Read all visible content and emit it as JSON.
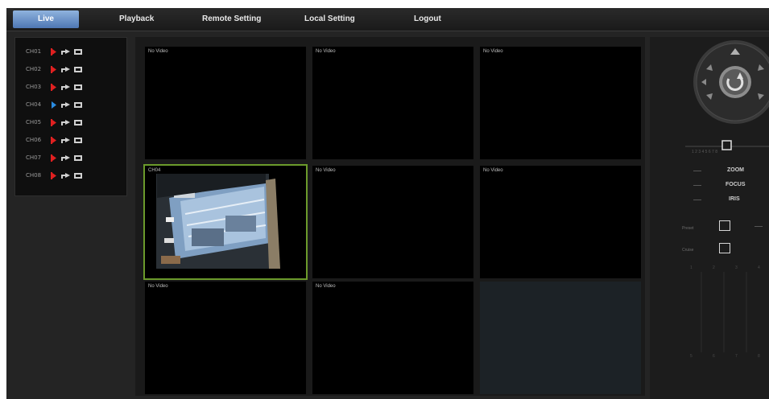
{
  "nav": {
    "tabs": [
      "Live",
      "Playback",
      "Remote Setting",
      "Local Setting",
      "Logout"
    ],
    "active_tab": "Live"
  },
  "channels": [
    {
      "name": "CH01",
      "playing": false
    },
    {
      "name": "CH02",
      "playing": false
    },
    {
      "name": "CH03",
      "playing": false
    },
    {
      "name": "CH04",
      "playing": true
    },
    {
      "name": "CH05",
      "playing": false
    },
    {
      "name": "CH06",
      "playing": false
    },
    {
      "name": "CH07",
      "playing": false
    },
    {
      "name": "CH08",
      "playing": false
    }
  ],
  "tiles": [
    {
      "label": "No Video"
    },
    {
      "label": "No Video"
    },
    {
      "label": "No Video"
    },
    {
      "label": "CH04"
    },
    {
      "label": "No Video"
    },
    {
      "label": "No Video"
    },
    {
      "label": "No Video"
    },
    {
      "label": "No Video"
    },
    {
      "label": ""
    }
  ],
  "ptz": {
    "zoom_label": "ZOOM",
    "focus_label": "FOCUS",
    "iris_label": "IRIS",
    "preset_label": "Preset",
    "cruise_label": "Cruise"
  },
  "colors": {
    "active_tab": "#6f97cc",
    "selected_tile_border": "#6b9a2b",
    "record_icon": "#e02020",
    "play_icon": "#2a8be0"
  }
}
